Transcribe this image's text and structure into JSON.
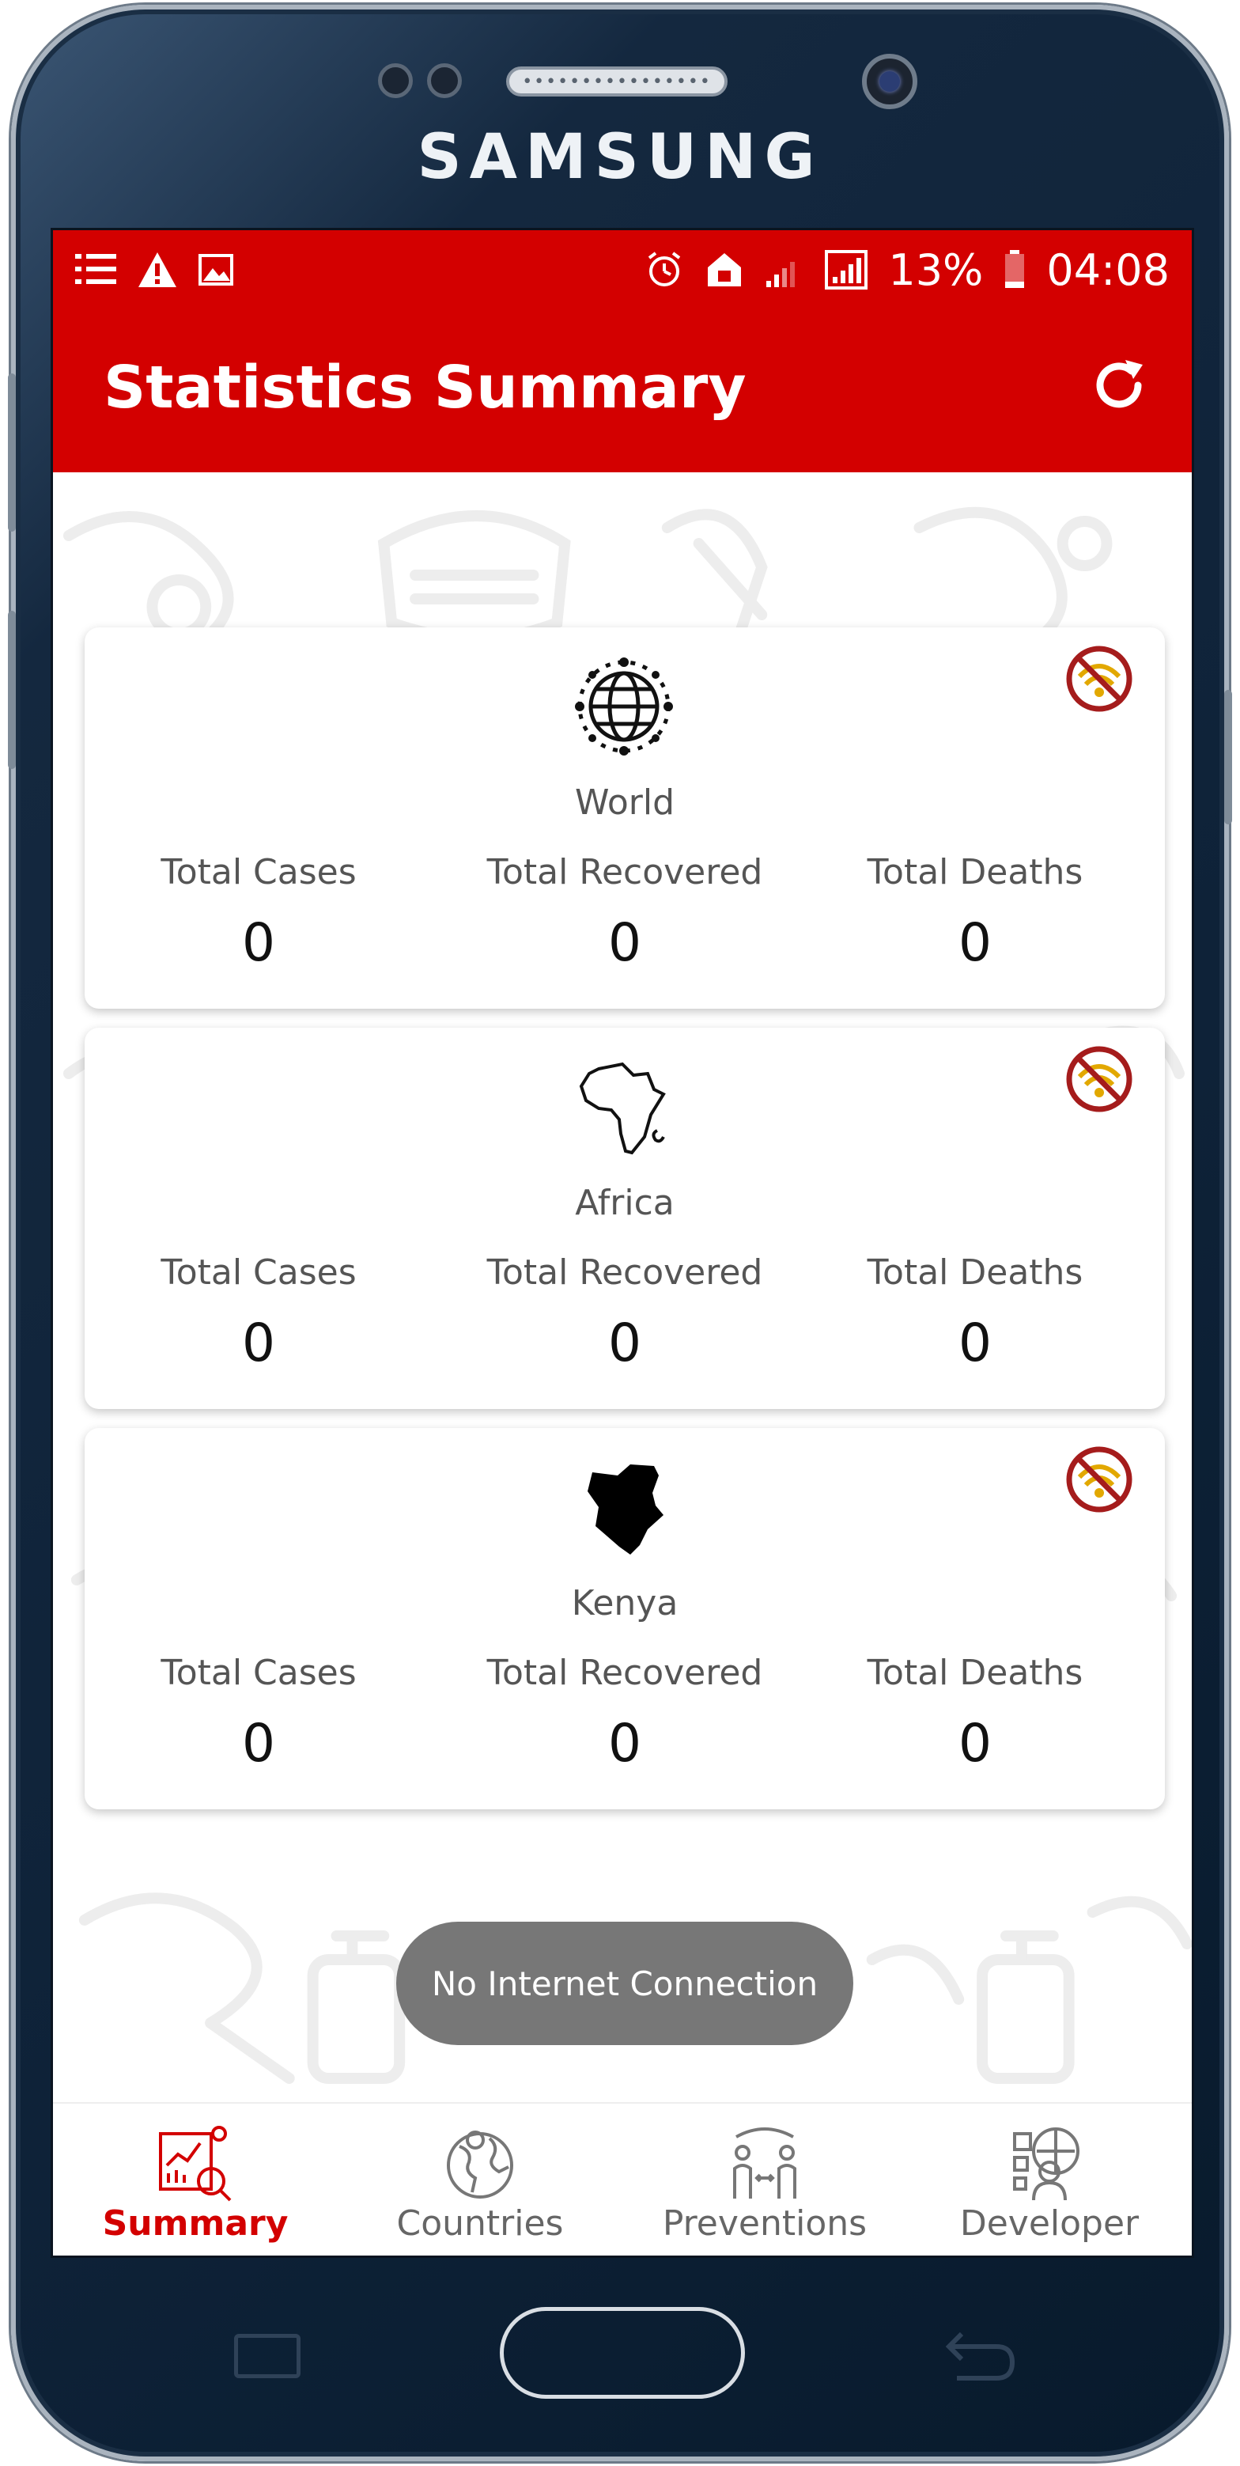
{
  "device": {
    "brand": "SAMSUNG"
  },
  "statusbar": {
    "left_icons": [
      "list-icon",
      "warning-icon",
      "image-icon"
    ],
    "right_icons": [
      "alarm-icon",
      "home-icon",
      "signal-weak-icon",
      "signal-icon"
    ],
    "battery_percent": "13%",
    "time": "04:08"
  },
  "appbar": {
    "title": "Statistics Summary",
    "refresh_icon": "refresh-icon"
  },
  "cards": [
    {
      "region": "World",
      "icon": "globe-icon",
      "labels": {
        "cases": "Total Cases",
        "recovered": "Total Recovered",
        "deaths": "Total Deaths"
      },
      "values": {
        "cases": "0",
        "recovered": "0",
        "deaths": "0"
      }
    },
    {
      "region": "Africa",
      "icon": "africa-map-icon",
      "labels": {
        "cases": "Total Cases",
        "recovered": "Total Recovered",
        "deaths": "Total Deaths"
      },
      "values": {
        "cases": "0",
        "recovered": "0",
        "deaths": "0"
      }
    },
    {
      "region": "Kenya",
      "icon": "kenya-map-icon",
      "labels": {
        "cases": "Total Cases",
        "recovered": "Total Recovered",
        "deaths": "Total Deaths"
      },
      "values": {
        "cases": "0",
        "recovered": "0",
        "deaths": "0"
      }
    }
  ],
  "toast": {
    "message": "No Internet Connection"
  },
  "bottomnav": {
    "items": [
      {
        "label": "Summary",
        "icon": "summary-chart-icon",
        "active": true
      },
      {
        "label": "Countries",
        "icon": "globe-icon",
        "active": false
      },
      {
        "label": "Preventions",
        "icon": "distancing-icon",
        "active": false
      },
      {
        "label": "Developer",
        "icon": "developer-icon",
        "active": false
      }
    ]
  },
  "colors": {
    "primary": "#d30000",
    "toast": "#777777"
  }
}
